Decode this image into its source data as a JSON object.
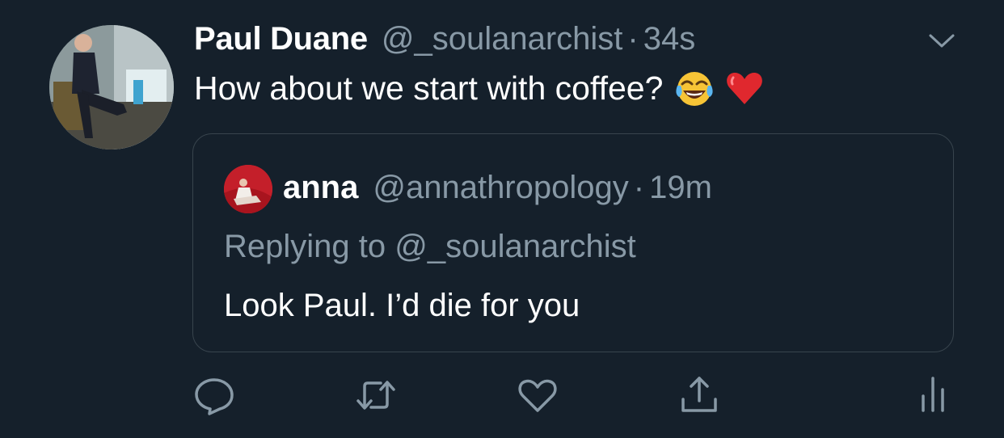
{
  "tweet": {
    "author_name": "Paul Duane",
    "author_handle": "@_soulanarchist",
    "separator": "·",
    "time": "34s",
    "text": "How about we start with coffee?",
    "emojis": [
      "face-with-tears-of-joy",
      "red-heart"
    ]
  },
  "quoted": {
    "author_name": "anna",
    "author_handle": "@annathropology",
    "separator": "·",
    "time": "19m",
    "replying_to": "Replying to @_soulanarchist",
    "text": "Look Paul. I’d die for you"
  },
  "actions": [
    {
      "icon": "reply-icon"
    },
    {
      "icon": "retweet-icon"
    },
    {
      "icon": "like-icon"
    },
    {
      "icon": "share-icon"
    },
    {
      "icon": "analytics-icon"
    }
  ],
  "colors": {
    "background": "#15202b",
    "primary_text": "#ffffff",
    "secondary_text": "#8899a6",
    "border": "#38444d"
  }
}
